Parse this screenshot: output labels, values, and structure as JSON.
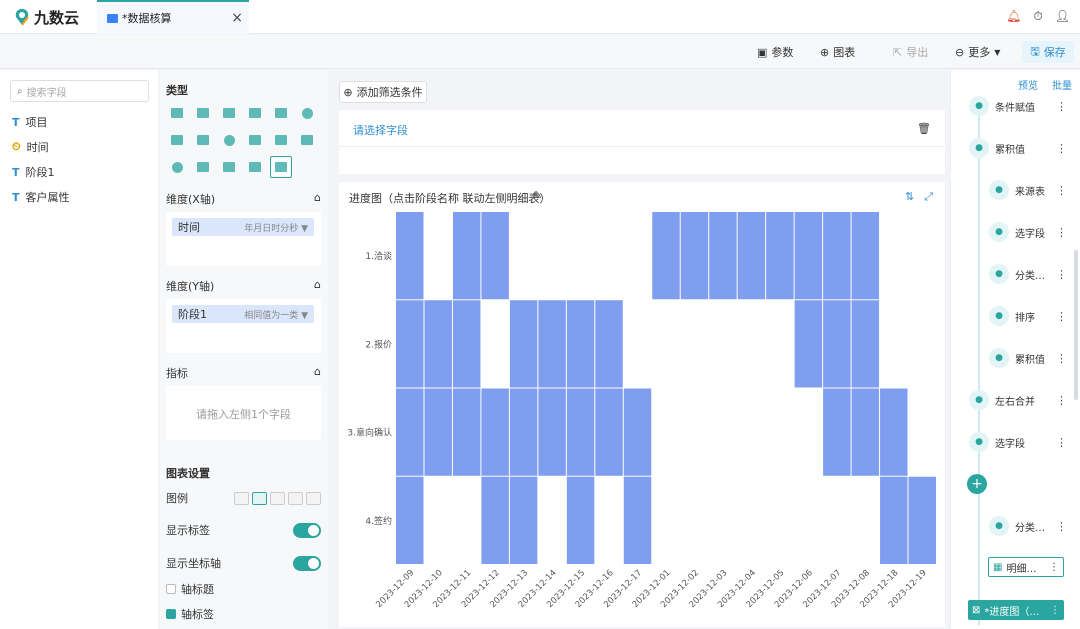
{
  "app": {
    "logo_text": "九数云"
  },
  "tab": {
    "label": "*数据核算",
    "close": "×"
  },
  "top_icons": [
    "bell-icon",
    "timer-icon",
    "user-icon"
  ],
  "toolbar": {
    "params": "参数",
    "chart": "图表",
    "export": "导出",
    "more": "更多",
    "save": "保存"
  },
  "fields": {
    "search_placeholder": "搜索字段",
    "items": [
      {
        "type": "T",
        "name": "项目"
      },
      {
        "type": "⏲",
        "name": "时间"
      },
      {
        "type": "T",
        "name": "阶段1"
      },
      {
        "type": "T",
        "name": "客户属性"
      }
    ]
  },
  "config": {
    "type_title": "类型",
    "dim_x": {
      "title": "维度(X轴)",
      "pill_name": "时间",
      "pill_desc": "年月日时分秒"
    },
    "dim_y": {
      "title": "维度(Y轴)",
      "pill_name": "阶段1",
      "pill_desc": "相同值为一类"
    },
    "metric": {
      "title": "指标",
      "hint": "请拖入左侧1个字段"
    },
    "settings_title": "图表设置",
    "legend_label": "图例",
    "show_labels": "显示标签",
    "show_axis": "显示坐标轴",
    "axis_title": "轴标题",
    "axis_label": "轴标签"
  },
  "filter": {
    "add_button": "添加筛选条件",
    "select_field": "请选择字段"
  },
  "chart_panel": {
    "title": "进度图（点击阶段名称 联动左侧明细表）"
  },
  "flow": {
    "preview": "预览",
    "batch": "批量",
    "nodes": [
      {
        "label": "条件赋值",
        "indent": 0
      },
      {
        "label": "累积值",
        "indent": 0
      },
      {
        "label": "来源表",
        "indent": 1
      },
      {
        "label": "选字段",
        "indent": 1
      },
      {
        "label": "分类…",
        "indent": 1
      },
      {
        "label": "排序",
        "indent": 1
      },
      {
        "label": "累积值",
        "indent": 1
      },
      {
        "label": "左右合并",
        "indent": 0
      },
      {
        "label": "选字段",
        "indent": 0
      },
      {
        "label": "分类…",
        "indent": 1
      }
    ],
    "box_node": "明细…",
    "selected_node": "*进度图（…",
    "more": "⋮"
  },
  "chart_data": {
    "type": "heatmap",
    "title": "进度图（点击阶段名称 联动左侧明细表）",
    "color": "#7f9ef0",
    "x_categories": [
      "2023-12-09",
      "2023-12-10",
      "2023-12-11",
      "2023-12-12",
      "2023-12-13",
      "2023-12-14",
      "2023-12-15",
      "2023-12-16",
      "2023-12-17",
      "2023-12-01",
      "2023-12-02",
      "2023-12-03",
      "2023-12-04",
      "2023-12-05",
      "2023-12-06",
      "2023-12-07",
      "2023-12-08",
      "2023-12-18",
      "2023-12-19"
    ],
    "y_categories": [
      "1.洽谈",
      "2.报价",
      "3.意向确认",
      "4.签约"
    ],
    "cells": [
      [
        1,
        0,
        1,
        1,
        0,
        0,
        0,
        0,
        0,
        1,
        1,
        1,
        1,
        1,
        1,
        1,
        1,
        0,
        0
      ],
      [
        1,
        1,
        1,
        0,
        1,
        1,
        1,
        1,
        0,
        0,
        0,
        0,
        0,
        0,
        1,
        1,
        1,
        0,
        0
      ],
      [
        1,
        1,
        1,
        1,
        1,
        1,
        1,
        1,
        1,
        0,
        0,
        0,
        0,
        0,
        0,
        1,
        1,
        1,
        0
      ],
      [
        1,
        0,
        0,
        1,
        1,
        0,
        1,
        0,
        1,
        0,
        0,
        0,
        0,
        0,
        0,
        0,
        0,
        1,
        1
      ]
    ]
  }
}
